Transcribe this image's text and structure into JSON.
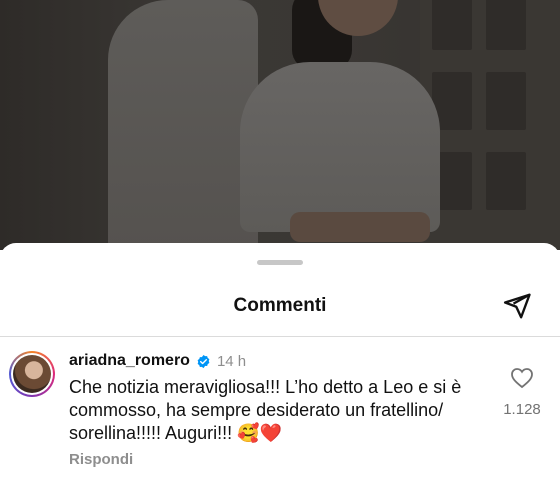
{
  "sheet": {
    "title": "Commenti"
  },
  "comment": {
    "username": "ariadna_romero",
    "timestamp": "14 h",
    "text": "Che notizia meravigliosa!!! L’ho detto a Leo e si è commosso, ha sempre desiderato un fratellino/ sorellina!!!!! Auguri!!!",
    "emojis": "🥰❤️",
    "reply_label": "Rispondi",
    "like_count": "1.128"
  },
  "icons": {
    "send": "paper-plane-icon",
    "verified": "verified-badge-icon",
    "like": "heart-outline-icon"
  },
  "colors": {
    "verified_blue": "#0095f6",
    "secondary_text": "#8e8e8e"
  }
}
